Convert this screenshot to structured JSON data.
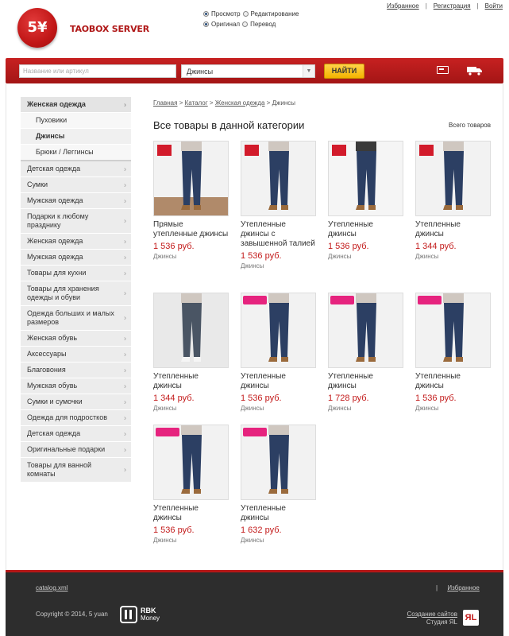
{
  "header": {
    "logo_badge": "5¥",
    "logo_text": "TAOBOX SERVER",
    "mode_view": "Просмотр",
    "mode_edit": "Редактирование",
    "mode_original": "Оригинал",
    "mode_translate": "Перевод",
    "link_favorites": "Избранное",
    "link_register": "Регистрация",
    "link_login": "Войти"
  },
  "searchbar": {
    "placeholder": "Название или артикул",
    "category_selected": "Джинсы",
    "find_label": "НАЙТИ",
    "card_icon": "wallet-card-icon",
    "truck_icon": "delivery-truck-icon"
  },
  "sidebar": {
    "items": [
      {
        "label": "Женская одежда",
        "kind": "head"
      },
      {
        "label": "Пуховики",
        "kind": "sub"
      },
      {
        "label": "Джинсы",
        "kind": "sub-active"
      },
      {
        "label": "Брюки / Леггинсы",
        "kind": "sub-last"
      },
      {
        "label": "Детская одежда"
      },
      {
        "label": "Сумки"
      },
      {
        "label": "Мужская одежда"
      },
      {
        "label": "Подарки к любому празднику"
      },
      {
        "label": "Женская одежда"
      },
      {
        "label": "Мужская одежда"
      },
      {
        "label": "Товары для кухни"
      },
      {
        "label": "Товары для хранения одежды и обуви"
      },
      {
        "label": "Одежда больших и малых размеров"
      },
      {
        "label": "Женская обувь"
      },
      {
        "label": "Аксессуары"
      },
      {
        "label": "Благовония"
      },
      {
        "label": "Мужская обувь"
      },
      {
        "label": "Сумки и сумочки"
      },
      {
        "label": "Одежда для подростков"
      },
      {
        "label": "Детская одежда"
      },
      {
        "label": "Оригинальные подарки"
      },
      {
        "label": "Товары для ванной комнаты"
      }
    ]
  },
  "breadcrumb": {
    "home": "Главная",
    "catalog": "Каталог",
    "women": "Женская одежда",
    "current": "Джинсы",
    "sep": ">"
  },
  "main": {
    "title": "Все товары в данной категории",
    "all_goods": "Всего товаров"
  },
  "products": [
    {
      "name": "Прямые утепленные джинсы",
      "price": "1 536 руб.",
      "category": "Джинсы"
    },
    {
      "name": "Утепленные джинсы с завышенной талией",
      "price": "1 536 руб.",
      "category": "Джинсы"
    },
    {
      "name": "Утепленные джинсы",
      "price": "1 536 руб.",
      "category": "Джинсы"
    },
    {
      "name": "Утепленные джинсы",
      "price": "1 344 руб.",
      "category": "Джинсы"
    },
    {
      "name": "Утепленные джинсы",
      "price": "1 344 руб.",
      "category": "Джинсы"
    },
    {
      "name": "Утепленные джинсы",
      "price": "1 536 руб.",
      "category": "Джинсы"
    },
    {
      "name": "Утепленные джинсы",
      "price": "1 728 руб.",
      "category": "Джинсы"
    },
    {
      "name": "Утепленные джинсы",
      "price": "1 536 руб.",
      "category": "Джинсы"
    },
    {
      "name": "Утепленные джинсы",
      "price": "1 536 руб.",
      "category": "Джинсы"
    },
    {
      "name": "Утепленные джинсы",
      "price": "1 632 руб.",
      "category": "Джинсы"
    }
  ],
  "footer": {
    "catalog_link": "catalog.xml",
    "favorites": "Избранное",
    "sep": "|",
    "copyright": "Copyright © 2014, 5 yuan",
    "rbk_line1": "RBK",
    "rbk_line2": "Money",
    "site_dev": "Создание сайтов",
    "studio": "Студия ЯL",
    "studio_logo": "ЯL"
  },
  "colors": {
    "brand_red": "#b41717",
    "price_red": "#c31b1b",
    "button_yellow": "#f4b400"
  }
}
